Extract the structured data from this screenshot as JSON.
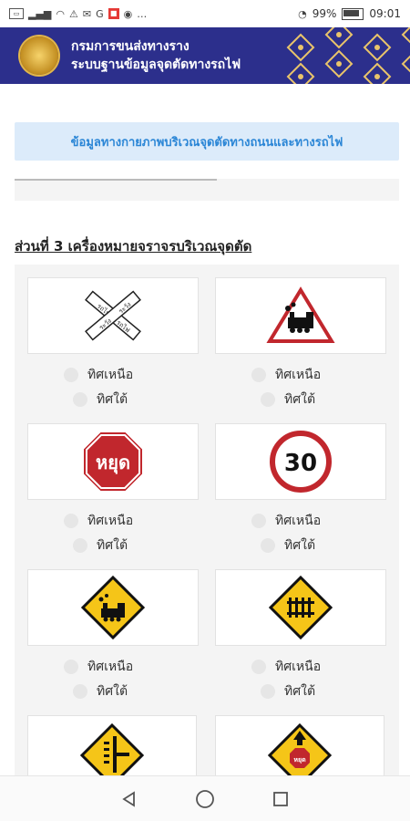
{
  "status_bar": {
    "battery": "99%",
    "time": "09:01"
  },
  "header": {
    "title_line1": "กรมการขนส่งทางราง",
    "title_line2": "ระบบฐานข้อมูลจุดตัดทางรถไฟ"
  },
  "banner": {
    "text": "ข้อมูลทางกายภาพบริเวณจุดตัดทางถนนและทางรถไฟ"
  },
  "section": {
    "title": "ส่วนที่ 3 เครื่องหมายจราจรบริเวณจุดตัด"
  },
  "options": {
    "north": "ทิศเหนือ",
    "south": "ทิศใต้"
  },
  "signs": [
    {
      "name": "crossbuck-sign"
    },
    {
      "name": "train-warning-triangle-sign"
    },
    {
      "name": "stop-sign",
      "text": "หยุด"
    },
    {
      "name": "speed-limit-sign",
      "text": "30"
    },
    {
      "name": "train-warning-diamond-sign"
    },
    {
      "name": "rail-crossing-diamond-sign"
    },
    {
      "name": "side-track-diamond-sign"
    },
    {
      "name": "stop-ahead-diamond-sign",
      "text": "หยุด"
    }
  ],
  "colors": {
    "header_bg": "#2c2f8c",
    "banner_bg": "#dcebfa",
    "banner_text": "#2b86d6",
    "sign_red": "#c1272d",
    "sign_yellow": "#f5c518"
  }
}
